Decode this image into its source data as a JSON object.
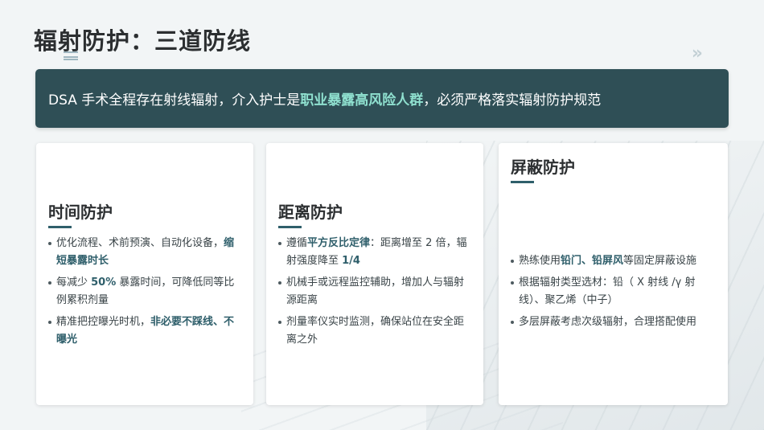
{
  "slide": {
    "title": "辐射防护：三道防线",
    "banner": {
      "prefix": "DSA 手术全程存在射线辐射，介入护士是",
      "highlight": "职业暴露高风险人群",
      "suffix": "，必须严格落实辐射防护规范"
    },
    "cards": [
      {
        "title": "时间防护",
        "items": [
          {
            "pre": "优化流程、术前预演、自动化设备，",
            "bold": "缩短暴露时长",
            "post": ""
          },
          {
            "pre": "每减少 ",
            "bold": "50%",
            "post": " 暴露时间，可降低同等比例累积剂量"
          },
          {
            "pre": "精准把控曝光时机，",
            "bold": "非必要不踩线、不曝光",
            "post": ""
          }
        ]
      },
      {
        "title": "距离防护",
        "items": [
          {
            "pre": "遵循",
            "bold": "平方反比定律",
            "post": "：距离增至 2 倍，辐射强度降至 "
          },
          {
            "pre": "机械手或远程监控辅助，增加人与辐射源距离",
            "bold": "",
            "post": ""
          },
          {
            "pre": "剂量率仪实时监测，确保站位在安全距离之外",
            "bold": "",
            "post": ""
          }
        ],
        "item0_tail_bold": "1/4"
      },
      {
        "title": "屏蔽防护",
        "items": [
          {
            "pre": "熟练使用",
            "bold": "铅门、铅屏风",
            "post": "等固定屏蔽设施"
          },
          {
            "pre": "根据辐射类型选材：铅（ X 射线 /γ 射线）、聚乙烯（中子）",
            "bold": "",
            "post": ""
          },
          {
            "pre": "多层屏蔽考虑次级辐射，合理搭配使用",
            "bold": "",
            "post": ""
          }
        ]
      }
    ]
  },
  "colors": {
    "banner_bg": "#2f4f56",
    "highlight": "#8fe0cf",
    "accent": "#2f5f6b"
  }
}
